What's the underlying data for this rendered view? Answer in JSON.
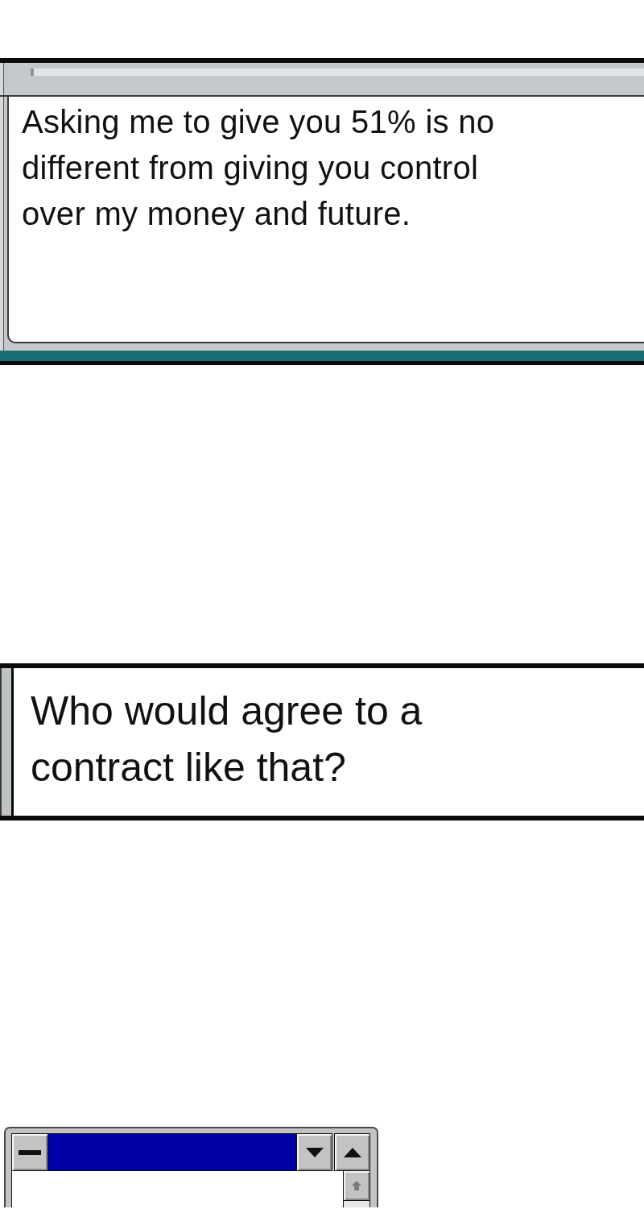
{
  "dialogs": [
    {
      "kind": "message_window",
      "lines": [
        "Asking me to give you 51% is no",
        "different from giving you control",
        "over my money and future."
      ]
    },
    {
      "kind": "text_box",
      "lines": [
        "Who would agree to a",
        "contract like that?"
      ]
    },
    {
      "kind": "app_window",
      "active": true
    }
  ]
}
